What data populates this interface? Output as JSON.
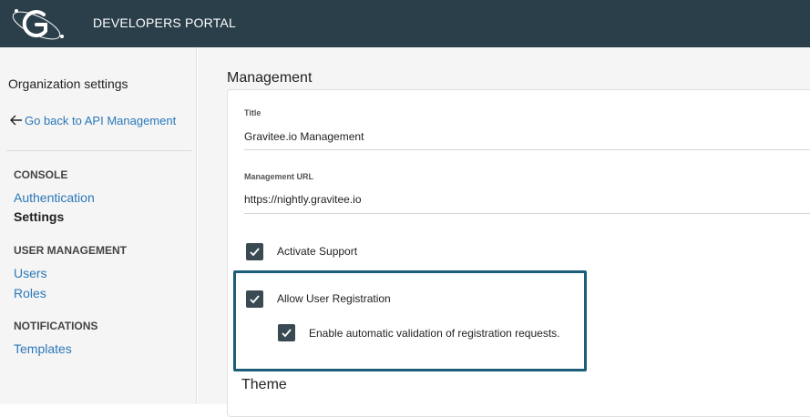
{
  "header": {
    "title": "DEVELOPERS PORTAL",
    "logo_icon": "gravitee-logo-icon"
  },
  "sidebar": {
    "title": "Organization settings",
    "back_link": "Go back to API Management",
    "sections": [
      {
        "heading": "CONSOLE",
        "items": [
          "Authentication",
          "Settings"
        ]
      },
      {
        "heading": "USER MANAGEMENT",
        "items": [
          "Users",
          "Roles"
        ]
      },
      {
        "heading": "NOTIFICATIONS",
        "items": [
          "Templates"
        ]
      }
    ],
    "active_item": "Settings"
  },
  "main": {
    "heading": "Management",
    "fields": [
      {
        "label": "Title",
        "value": "Gravitee.io Management"
      },
      {
        "label": "Management URL",
        "value": "https://nightly.gravitee.io"
      }
    ],
    "checkboxes": [
      {
        "label": "Activate Support",
        "checked": true
      },
      {
        "label": "Allow User Registration",
        "checked": true
      },
      {
        "label": "Enable automatic validation of registration requests.",
        "checked": true
      }
    ],
    "theme_heading": "Theme"
  },
  "colors": {
    "topbar": "#2b3f4b",
    "link": "#2a78b8",
    "checkbox": "#3a4a52",
    "highlight": "#1c5e78"
  }
}
